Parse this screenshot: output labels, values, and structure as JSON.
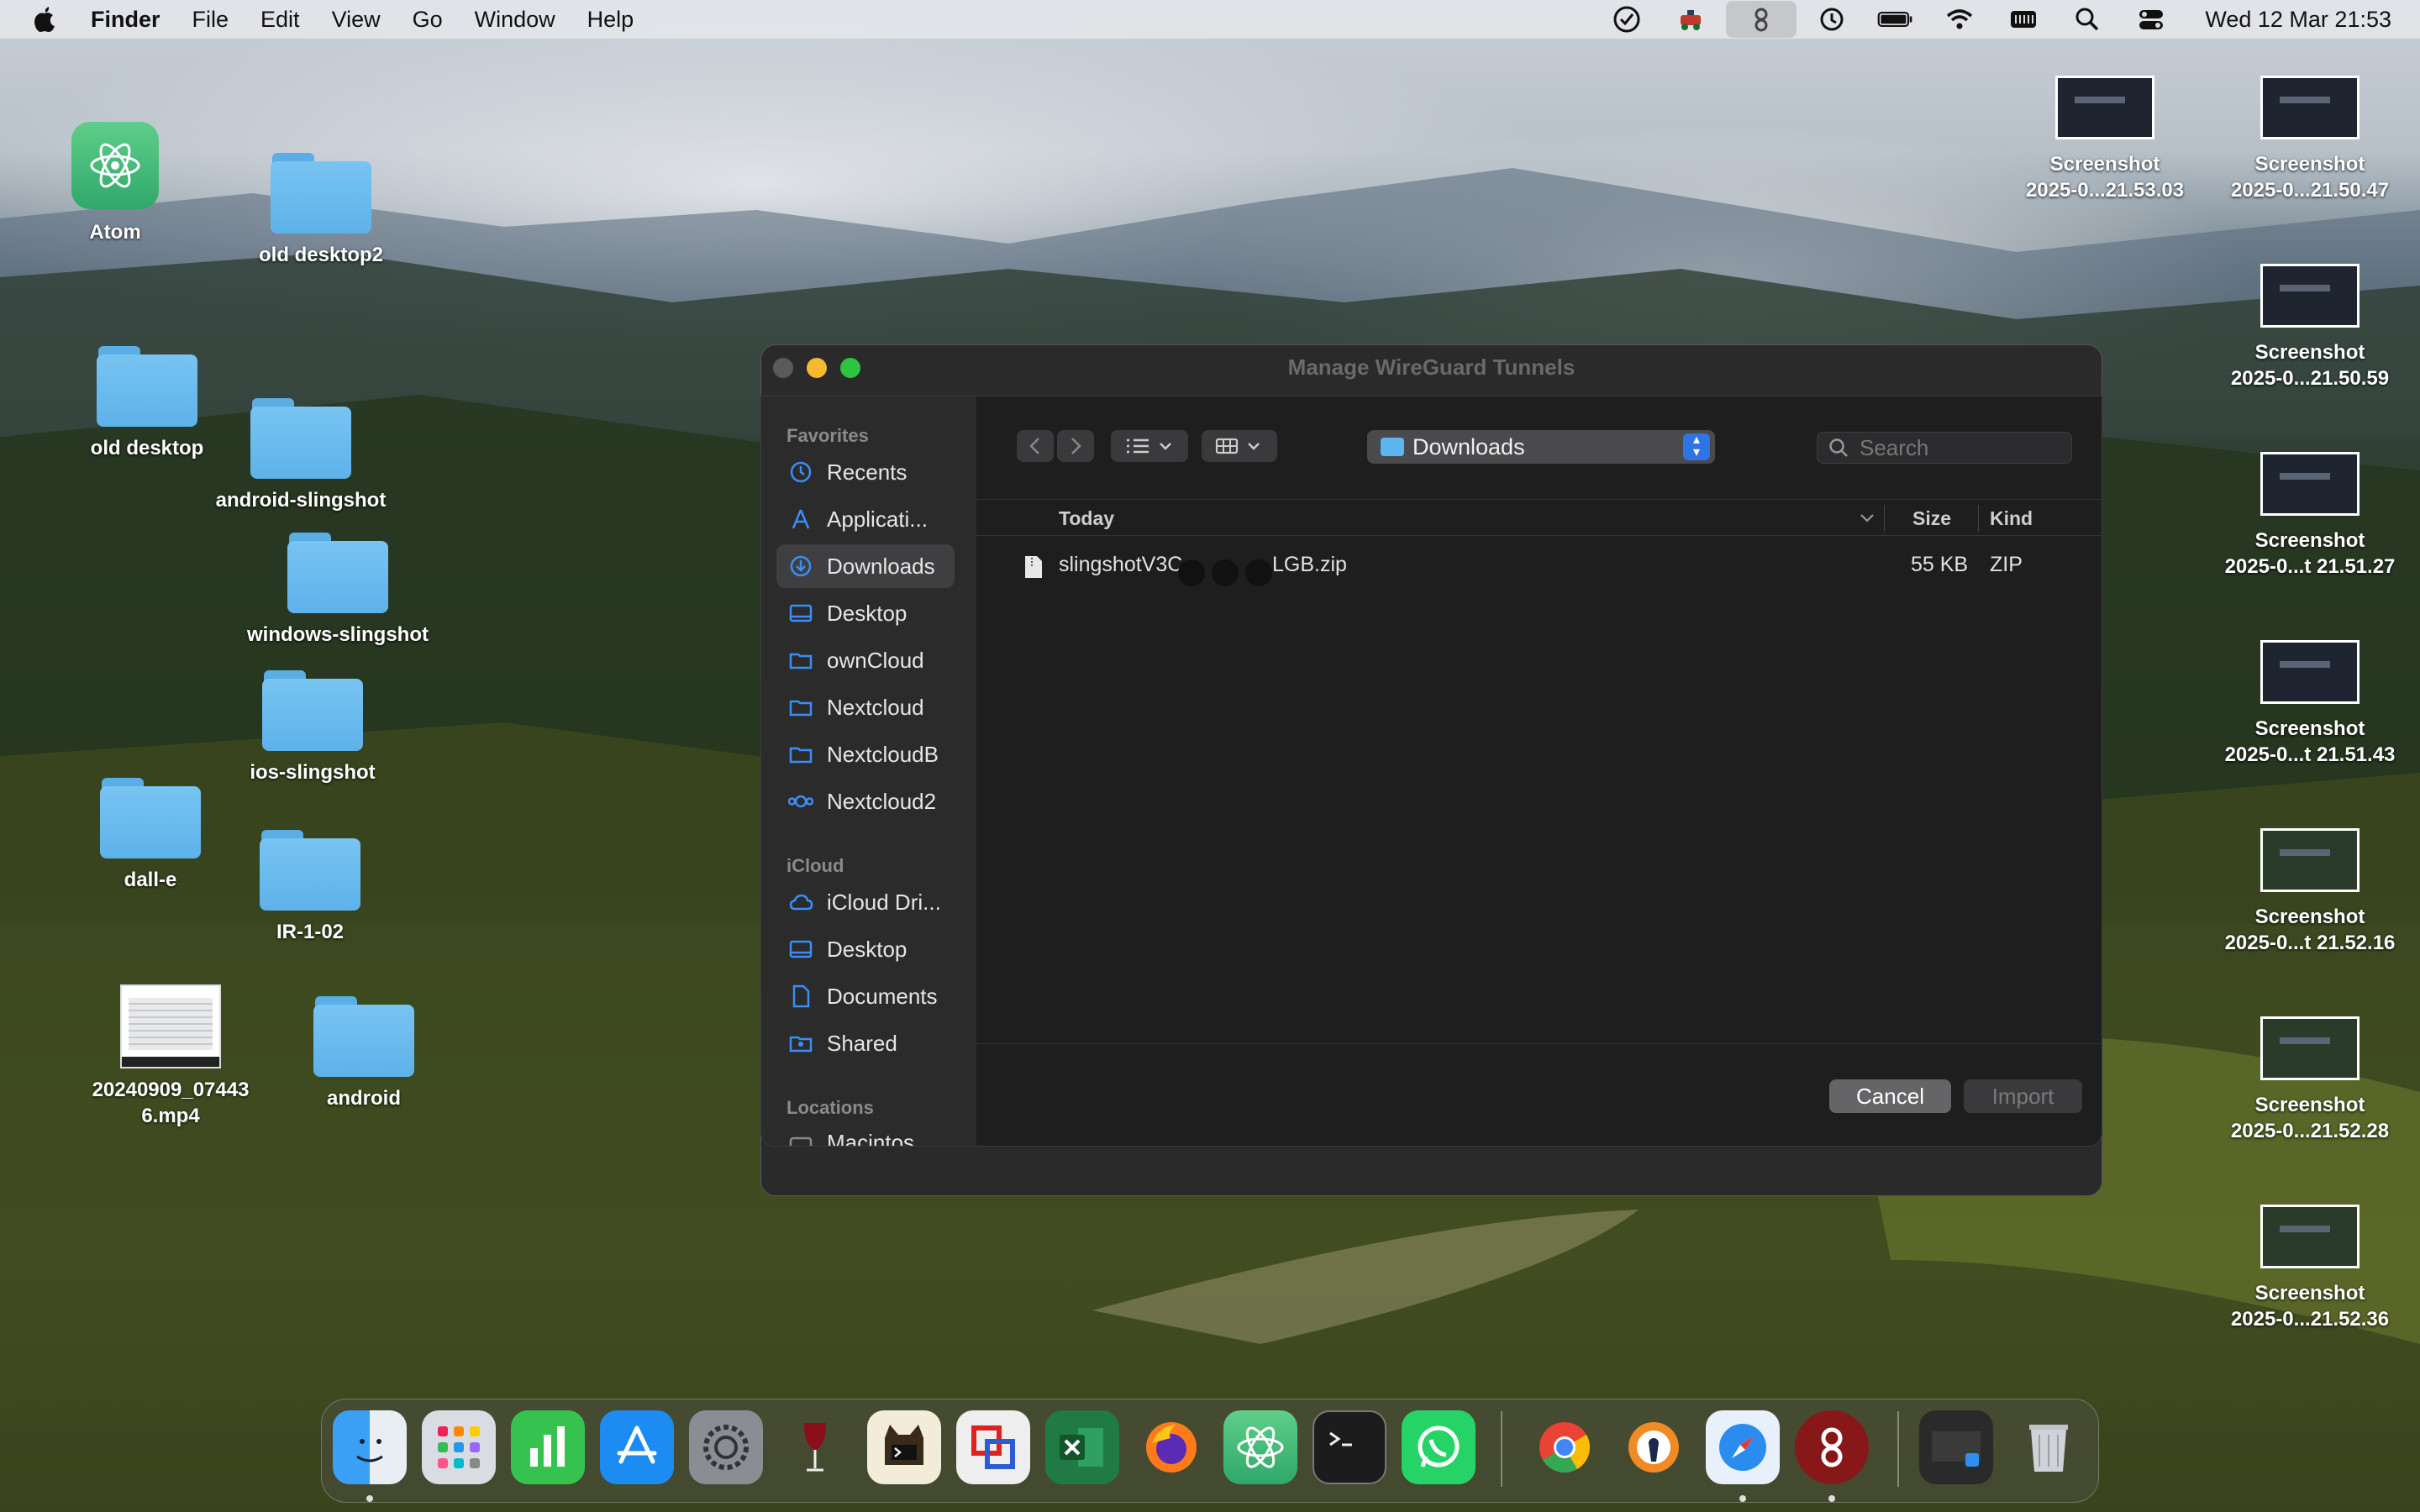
{
  "menubar": {
    "app_name": "Finder",
    "menus": [
      "File",
      "Edit",
      "View",
      "Go",
      "Window",
      "Help"
    ],
    "clock": "Wed 12 Mar  21:53",
    "status_icons": [
      "checkmark-circle-icon",
      "app-status-icon",
      "wireguard-icon",
      "time-machine-icon",
      "battery-icon",
      "wifi-icon",
      "keyboard-icon",
      "spotlight-icon",
      "control-center-icon"
    ]
  },
  "desktop": {
    "left_icons": [
      {
        "label": "Atom",
        "kind": "app"
      },
      {
        "label": "old desktop2",
        "kind": "folder"
      },
      {
        "label": "old desktop",
        "kind": "folder"
      },
      {
        "label": "android-slingshot",
        "kind": "folder"
      },
      {
        "label": "windows-slingshot",
        "kind": "folder"
      },
      {
        "label": "ios-slingshot",
        "kind": "folder"
      },
      {
        "label": "dall-e",
        "kind": "folder"
      },
      {
        "label": "IR-1-02",
        "kind": "folder"
      },
      {
        "label": "20240909_07443",
        "label2": "6.mp4",
        "kind": "video"
      },
      {
        "label": "android",
        "kind": "folder"
      }
    ],
    "screenshots": [
      {
        "l1": "Screenshot",
        "l2": "2025-0...21.53.03"
      },
      {
        "l1": "Screenshot",
        "l2": "2025-0...21.50.47"
      },
      {
        "l1": "Screenshot",
        "l2": "2025-0...21.50.59"
      },
      {
        "l1": "Screenshot",
        "l2": "2025-0...t 21.51.27"
      },
      {
        "l1": "Screenshot",
        "l2": "2025-0...t 21.51.43"
      },
      {
        "l1": "Screenshot",
        "l2": "2025-0...t 21.52.16"
      },
      {
        "l1": "Screenshot",
        "l2": "2025-0...21.52.28"
      },
      {
        "l1": "Screenshot",
        "l2": "2025-0...21.52.36"
      }
    ]
  },
  "window": {
    "title": "Manage WireGuard Tunnels"
  },
  "dialog": {
    "sidebar": {
      "favorites_header": "Favorites",
      "favorites": [
        {
          "label": "Recents",
          "icon": "clock-icon"
        },
        {
          "label": "Applicati...",
          "icon": "applications-icon"
        },
        {
          "label": "Downloads",
          "icon": "download-icon",
          "selected": true
        },
        {
          "label": "Desktop",
          "icon": "desktop-icon"
        },
        {
          "label": "ownCloud",
          "icon": "folder-icon"
        },
        {
          "label": "Nextcloud",
          "icon": "folder-icon"
        },
        {
          "label": "NextcloudB",
          "icon": "folder-icon"
        },
        {
          "label": "Nextcloud2",
          "icon": "nextcloud-icon"
        }
      ],
      "icloud_header": "iCloud",
      "icloud": [
        {
          "label": "iCloud Dri...",
          "icon": "cloud-icon"
        },
        {
          "label": "Desktop",
          "icon": "desktop-icon"
        },
        {
          "label": "Documents",
          "icon": "document-icon"
        },
        {
          "label": "Shared",
          "icon": "shared-folder-icon"
        }
      ],
      "locations_header": "Locations",
      "locations": [
        {
          "label": "Macintos...",
          "icon": "disk-icon"
        }
      ]
    },
    "location": "Downloads",
    "search_placeholder": "Search",
    "columns": {
      "name": "Today",
      "size": "Size",
      "kind": "Kind"
    },
    "files": [
      {
        "name": "slingshotV3C",
        "name_tail": "LGB.zip",
        "size": "55 KB",
        "kind": "ZIP"
      }
    ],
    "cancel_label": "Cancel",
    "import_label": "Import"
  },
  "dock": {
    "apps": [
      "Finder",
      "Launchpad",
      "Numbers",
      "App Store",
      "System Settings",
      "Wine",
      "Terminal Cat",
      "Parallels",
      "Excel",
      "Firefox",
      "Atom",
      "Terminal",
      "WhatsApp",
      "Chrome",
      "OpenVPN",
      "Safari",
      "WireGuard",
      "Screen Preview",
      "Trash"
    ],
    "colors": {
      "finder": "#2e8ff0",
      "numbers": "#35c24f",
      "appstore": "#1c8cf3",
      "excel": "#1f7a44",
      "whatsapp": "#25d366",
      "wireguard": "#88171a",
      "chrome": "#ea4335"
    }
  }
}
